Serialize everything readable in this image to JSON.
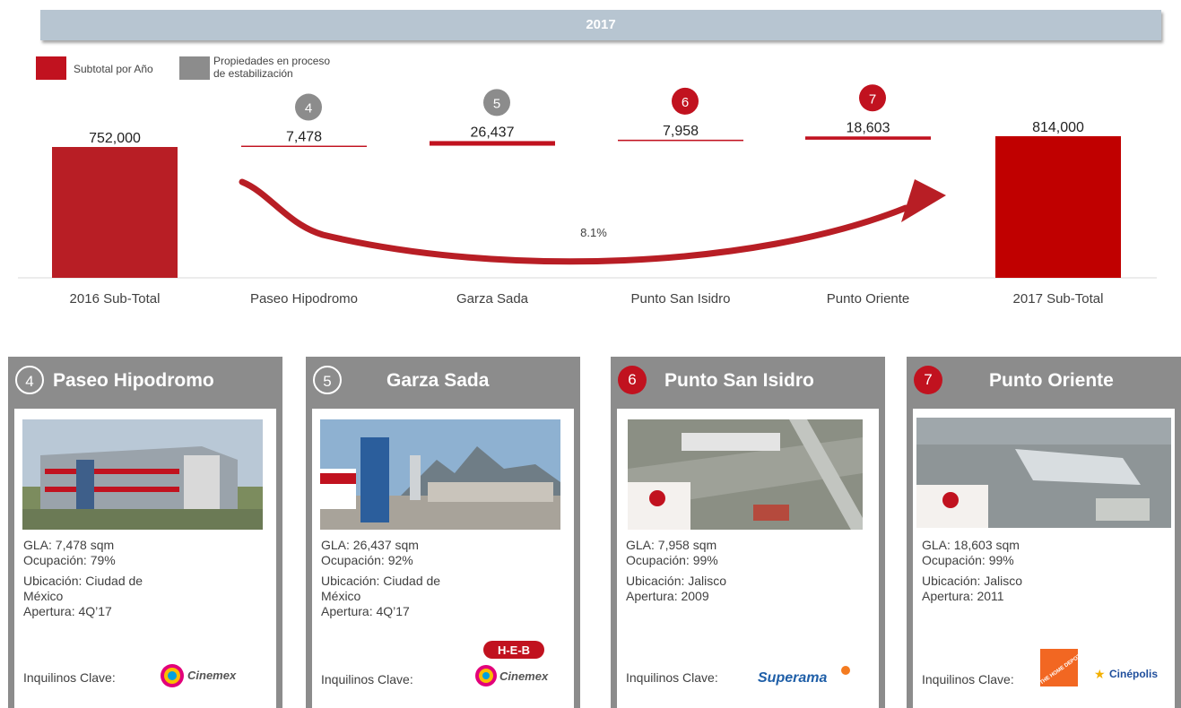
{
  "header": {
    "title": "2017"
  },
  "legend": {
    "items": [
      {
        "label": "Subtotal por Año",
        "color": "#c1121f"
      },
      {
        "label_line1": "Propiedades en proceso",
        "label_line2": "de estabilización",
        "color": "#8c8c8c"
      }
    ]
  },
  "chart_data": {
    "type": "bar",
    "categories": [
      "2016 Sub-Total",
      "Paseo Hipodromo",
      "Garza Sada",
      "Punto San Isidro",
      "Punto Oriente",
      "2017 Sub-Total"
    ],
    "values": [
      752000,
      7478,
      26437,
      7958,
      18603,
      814000
    ],
    "value_labels": [
      "752,000",
      "7,478",
      "26,437",
      "7,958",
      "18,603",
      "814,000"
    ],
    "badges": [
      "",
      "4",
      "5",
      "6",
      "7",
      ""
    ],
    "badge_colors": [
      "",
      "#8c8c8c",
      "#8c8c8c",
      "#c1121f",
      "#c1121f",
      ""
    ],
    "bar_colors": [
      "#b81e25",
      "#c1121f",
      "#c1121f",
      "#c1121f",
      "#c1121f",
      "#c00000"
    ],
    "growth_label": "8.1%"
  },
  "cards": [
    {
      "number": "4",
      "badge": "grey",
      "title": "Paseo Hipodromo",
      "gla": "GLA: 7,478 sqm",
      "ocupacion": "Ocupación: 79%",
      "ubicacion_1": "Ubicación: Ciudad de",
      "ubicacion_2": "México",
      "apertura": "Apertura: 4Q’17",
      "tenants_label": "Inquilinos Clave:",
      "logos": [
        "Cinemex"
      ]
    },
    {
      "number": "5",
      "badge": "grey",
      "title": "Garza Sada",
      "gla": "GLA: 26,437 sqm",
      "ocupacion": "Ocupación: 92%",
      "ubicacion_1": "Ubicación: Ciudad de",
      "ubicacion_2": "México",
      "apertura": "Apertura: 4Q’17",
      "tenants_label": "Inquilinos Clave:",
      "logos": [
        "H-E-B",
        "Cinemex"
      ]
    },
    {
      "number": "6",
      "badge": "red",
      "title": "Punto San Isidro",
      "gla": "GLA: 7,958 sqm",
      "ocupacion": "Ocupación: 99%",
      "ubicacion_1": "Ubicación: Jalisco",
      "ubicacion_2": "",
      "apertura": "Apertura: 2009",
      "tenants_label": "Inquilinos Clave:",
      "logos": [
        "Superama"
      ]
    },
    {
      "number": "7",
      "badge": "red",
      "title": "Punto Oriente",
      "gla": "GLA: 18,603 sqm",
      "ocupacion": "Ocupación: 99%",
      "ubicacion_1": "Ubicación:  Jalisco",
      "ubicacion_2": "",
      "apertura": "Apertura: 2011",
      "tenants_label": "Inquilinos Clave:",
      "logos": [
        "THE HOME DEPOT",
        "Cinépolis"
      ]
    }
  ]
}
